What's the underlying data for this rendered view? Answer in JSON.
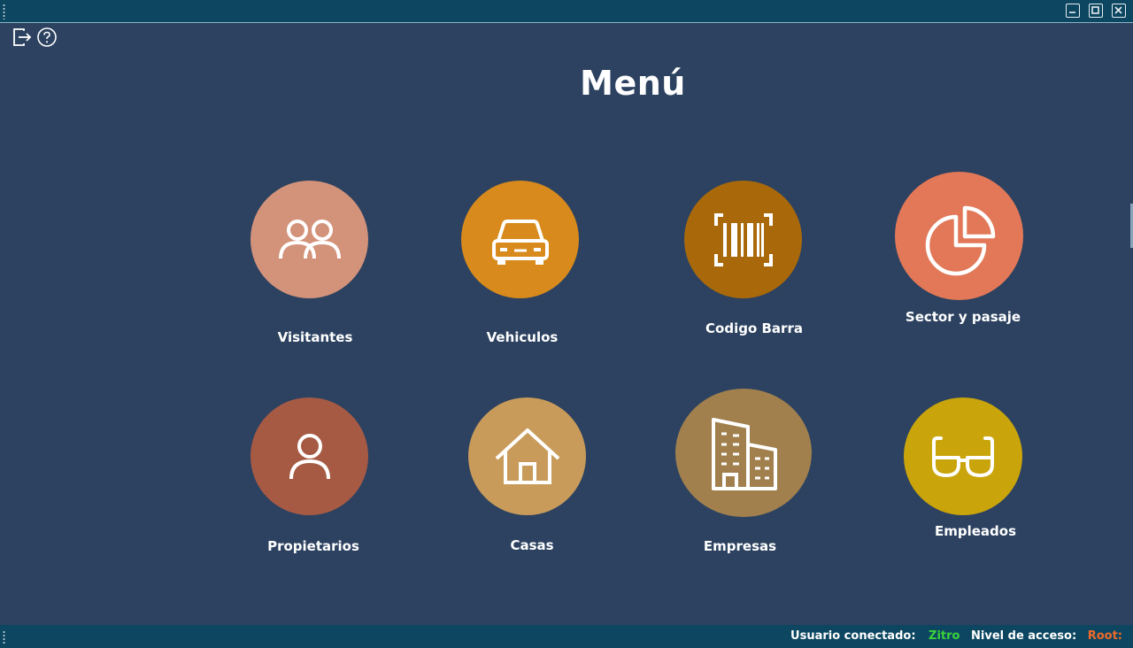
{
  "window": {
    "controls": [
      {
        "name": "minimize-button",
        "icon": "minimize-icon"
      },
      {
        "name": "maximize-button",
        "icon": "maximize-icon"
      },
      {
        "name": "close-button",
        "icon": "close-icon"
      }
    ]
  },
  "toolbar": {
    "icons": [
      "logout-icon",
      "help-icon"
    ]
  },
  "header": {
    "title": "Menú"
  },
  "menu": {
    "items": [
      {
        "label": "Visitantes",
        "icon": "people-icon",
        "color": "#d3927a"
      },
      {
        "label": "Vehiculos",
        "icon": "car-icon",
        "color": "#d88a1c"
      },
      {
        "label": "Codigo Barra",
        "icon": "barcode-icon",
        "color": "#a9690b"
      },
      {
        "label": "Sector y pasaje",
        "icon": "pie-chart-icon",
        "color": "#e27858"
      },
      {
        "label": "Propietarios",
        "icon": "person-icon",
        "color": "#a65a44"
      },
      {
        "label": "Casas",
        "icon": "house-icon",
        "color": "#c99b5a"
      },
      {
        "label": "Empresas",
        "icon": "buildings-icon",
        "color": "#a1804e"
      },
      {
        "label": "Empleados",
        "icon": "glasses-icon",
        "color": "#c9a40b"
      }
    ]
  },
  "status": {
    "user_label": "Usuario conectado:",
    "user_value": "Zitro",
    "level_label": "Nivel de acceso:",
    "level_value": "Root:"
  },
  "colors": {
    "background": "#2c4260",
    "titlebar": "#0c4660",
    "user": "#3bd23b",
    "level": "#f06a2a"
  }
}
